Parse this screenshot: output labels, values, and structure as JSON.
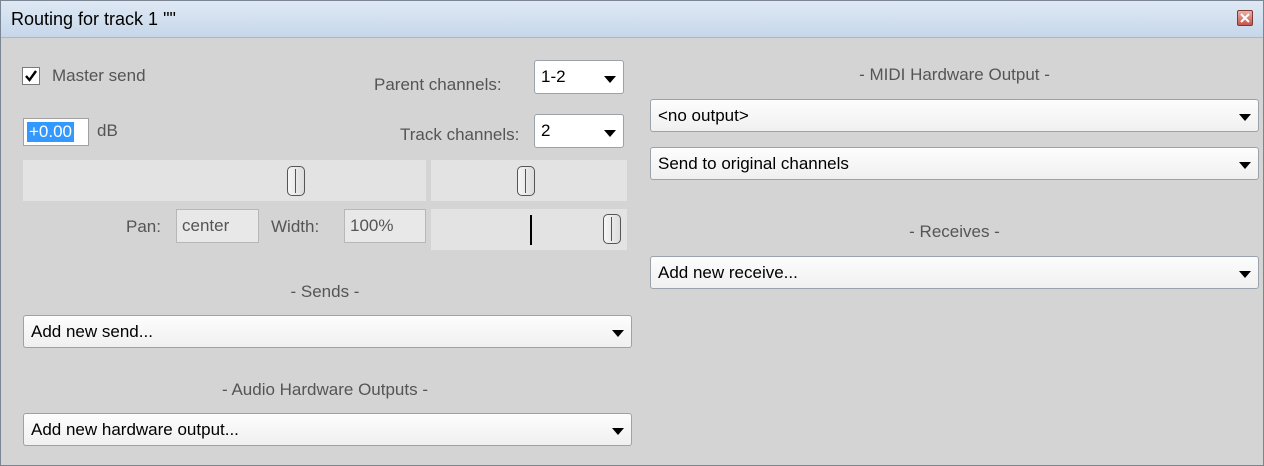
{
  "window": {
    "title": "Routing for track 1 \"\""
  },
  "master": {
    "send_label": "Master send",
    "checked": true,
    "volume_value": "+0.00",
    "volume_unit": "dB",
    "parent_channels_label": "Parent channels:",
    "parent_channels_value": "1-2",
    "track_channels_label": "Track channels:",
    "track_channels_value": "2",
    "pan_label": "Pan:",
    "pan_value": "center",
    "width_label": "Width:",
    "width_value": "100%"
  },
  "sends": {
    "header": "- Sends -",
    "select_value": "Add new send..."
  },
  "audio_hw": {
    "header": "- Audio Hardware Outputs -",
    "select_value": "Add new hardware output..."
  },
  "midi_hw": {
    "header": "- MIDI Hardware Output -",
    "output_value": "<no output>",
    "channels_value": "Send to original channels"
  },
  "receives": {
    "header": "- Receives -",
    "select_value": "Add new receive..."
  },
  "icons": {
    "close": "close-icon",
    "checkmark": "checkmark-icon",
    "dropdown": "chevron-down-icon"
  },
  "colors": {
    "selection": "#3399ff",
    "window_bg": "#d4d4d4",
    "title_bg": "#c6d7ea"
  }
}
